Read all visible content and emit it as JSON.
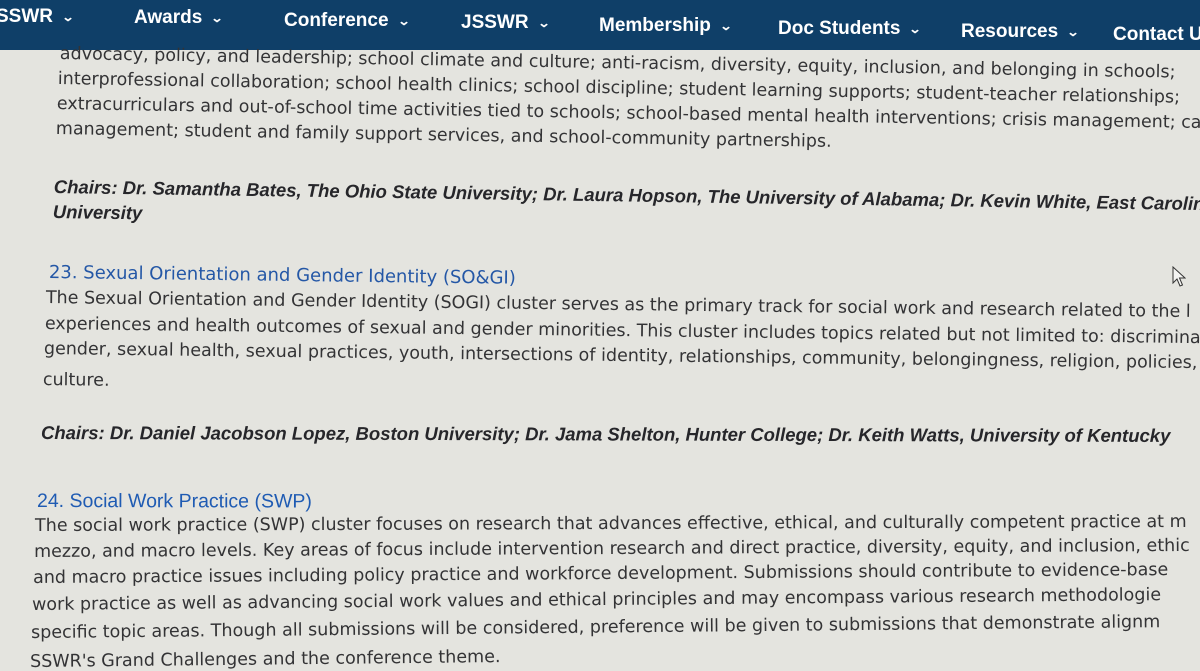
{
  "nav": {
    "items": [
      {
        "label": "SSWR"
      },
      {
        "label": "Awards"
      },
      {
        "label": "Conference"
      },
      {
        "label": "JSSWR"
      },
      {
        "label": "Membership"
      },
      {
        "label": "Doc Students"
      },
      {
        "label": "Resources"
      },
      {
        "label": "Contact Us"
      }
    ],
    "chevron_icon": "chevron-down-icon"
  },
  "section22": {
    "description_lines": [
      "advocacy, policy, and leadership; school climate and culture; anti-racism, diversity, equity, inclusion, and belonging in schools;",
      "interprofessional collaboration; school health clinics; school discipline; student learning supports; student-teacher relationships;",
      "extracurriculars and out-of-school time activities tied to schools; school-based mental health interventions; crisis management; case",
      "management; student and family support services, and school-community partnerships."
    ],
    "chairs_lines": [
      "Chairs: Dr. Samantha Bates, The Ohio State University; Dr. Laura Hopson, The University of Alabama; Dr. Kevin White, East Carolina",
      "University"
    ]
  },
  "section23": {
    "heading": "23. Sexual Orientation and Gender Identity (SO&GI)",
    "description_lines": [
      "The Sexual Orientation and Gender Identity (SOGI) cluster serves as the primary track for social work and research related to the l",
      "experiences and health outcomes of sexual and gender minorities. This cluster includes topics related but not limited to: discrimina",
      "gender, sexual health, sexual practices, youth, intersections of identity, relationships, community, belongingness, religion, policies,",
      "culture."
    ],
    "chairs": "Chairs: Dr. Daniel Jacobson Lopez, Boston University; Dr. Jama Shelton, Hunter College; Dr. Keith Watts, University of Kentucky"
  },
  "section24": {
    "heading": "24. Social Work Practice (SWP)",
    "description_lines": [
      "The social work practice (SWP) cluster focuses on research that advances effective, ethical, and culturally competent practice at m",
      "mezzo, and macro levels. Key areas of focus include intervention research and direct practice, diversity, equity, and inclusion, ethic",
      "and macro practice issues including policy practice and workforce development. Submissions should contribute to evidence-base",
      "work practice as well as advancing social work values and ethical principles and may encompass various research methodologie",
      "specific topic areas. Though all submissions will be considered, preference will be given to submissions that demonstrate alignm",
      "SSWR's Grand Challenges and the conference theme."
    ]
  },
  "cursor_icon": "mouse-pointer-icon"
}
